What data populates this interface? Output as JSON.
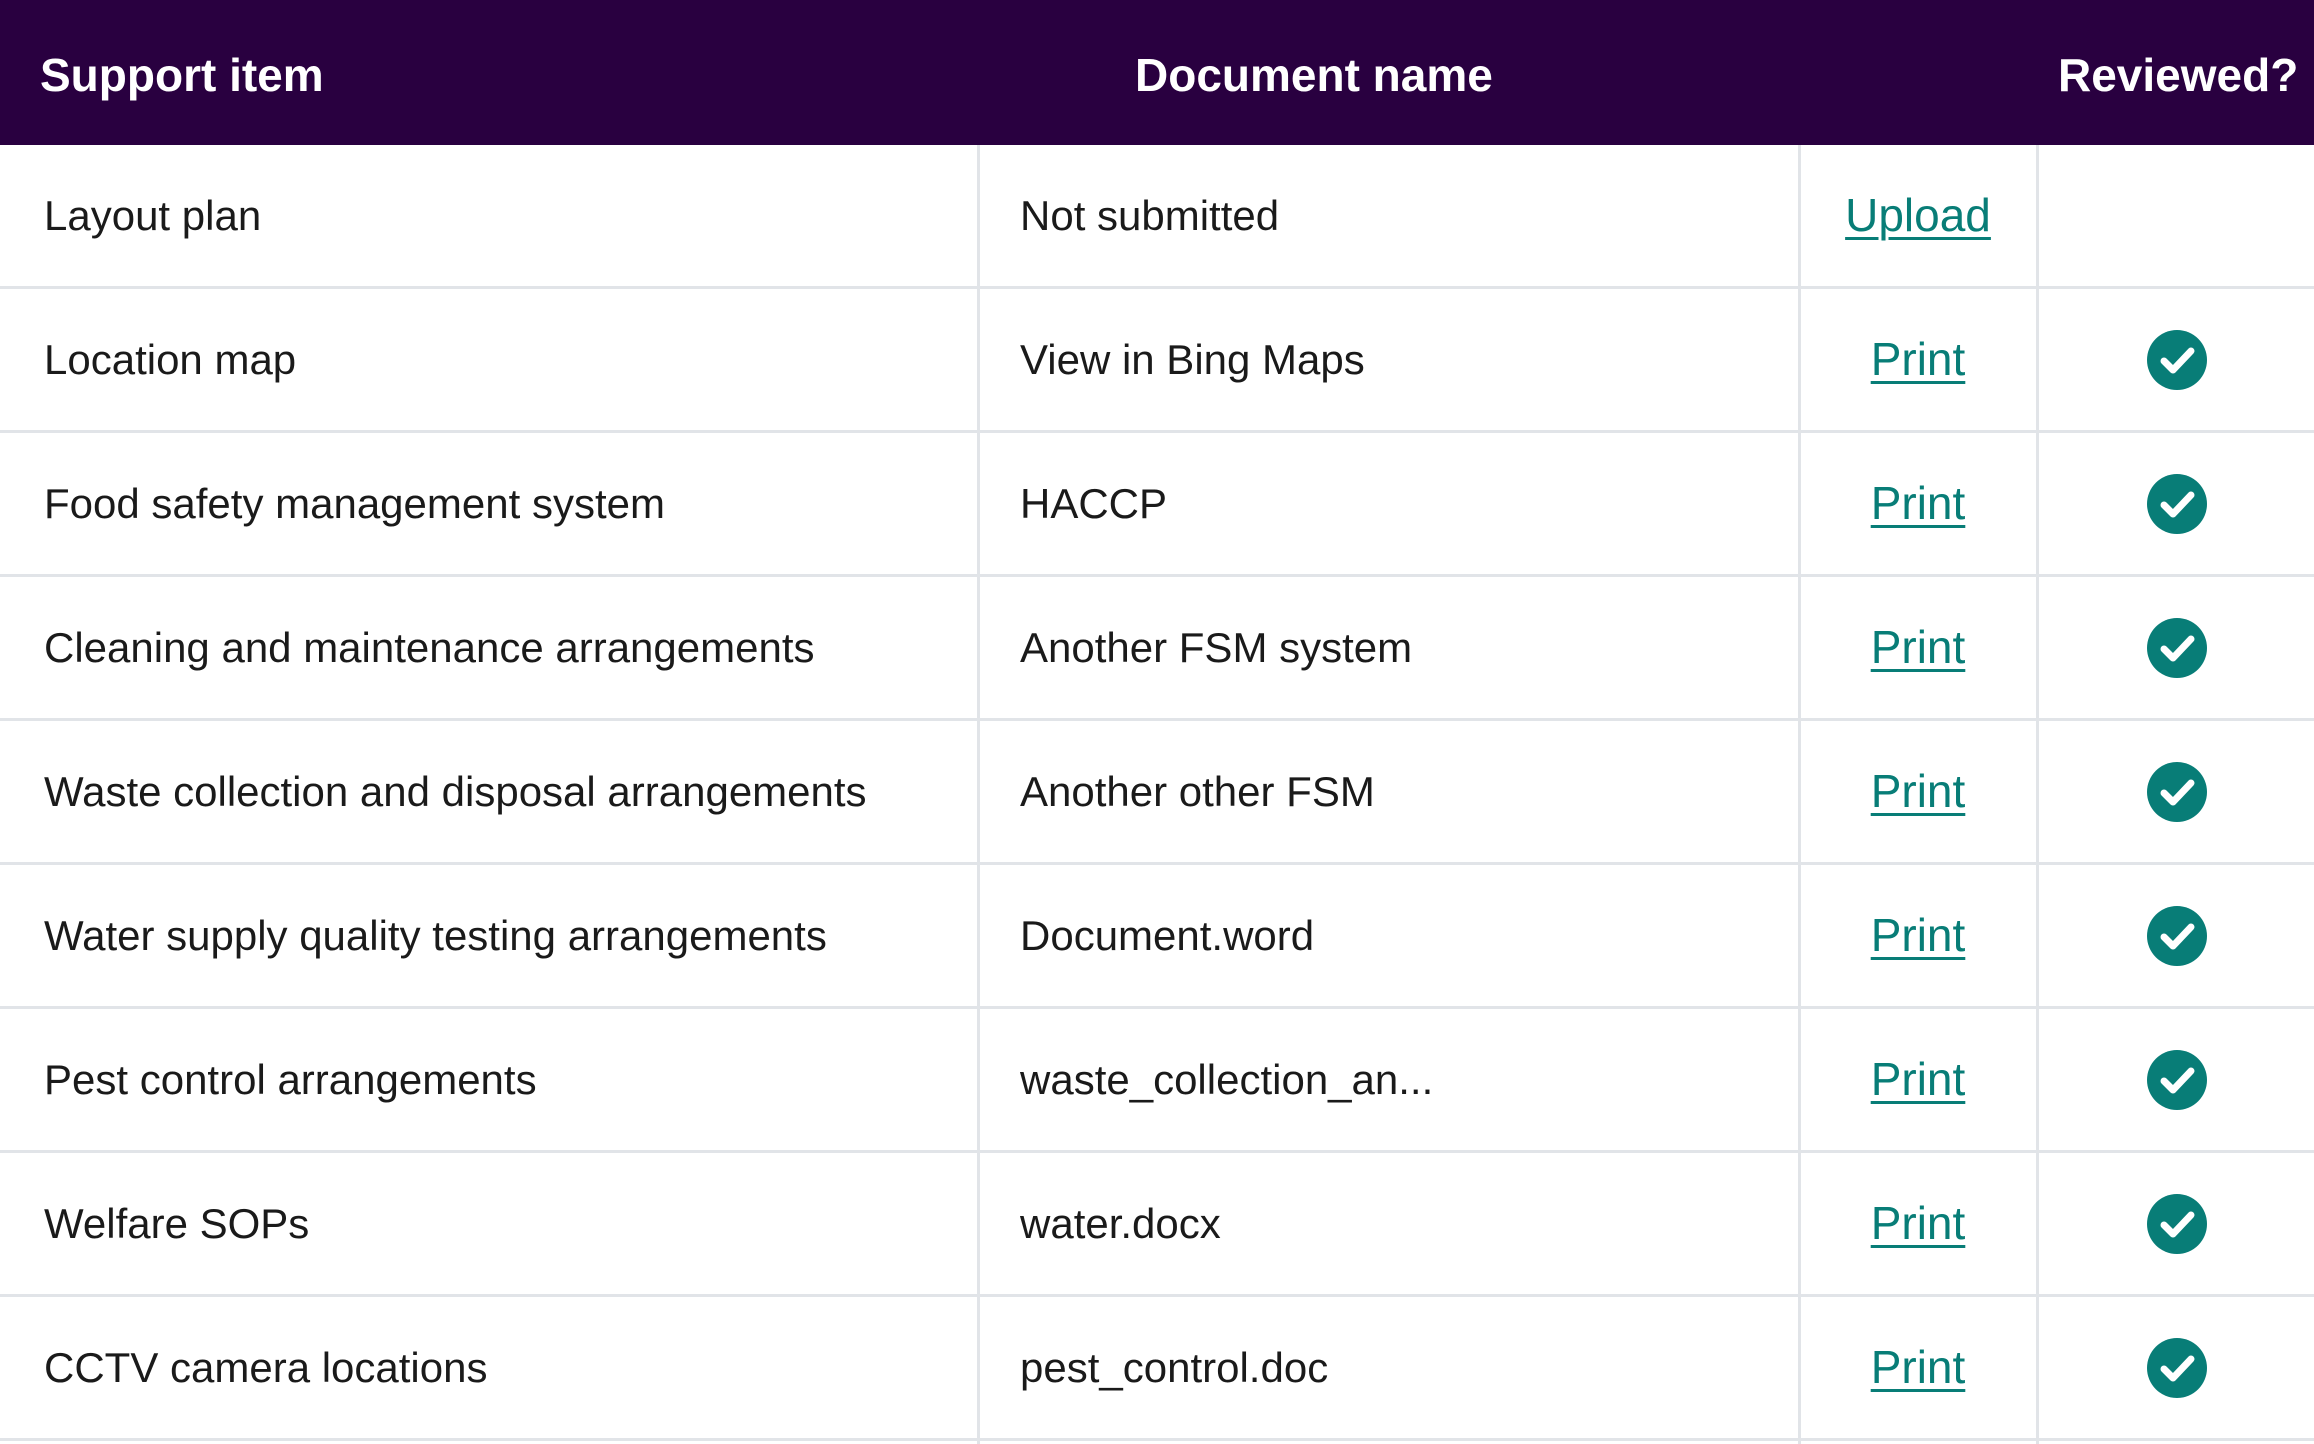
{
  "table": {
    "headers": {
      "support_item": "Support item",
      "document_name": "Document name",
      "reviewed": "Reviewed?"
    },
    "rows": [
      {
        "support_item": "Layout plan",
        "document_name": "Not submitted",
        "action": "Upload",
        "reviewed": false
      },
      {
        "support_item": "Location map",
        "document_name": "View in Bing Maps",
        "action": "Print",
        "reviewed": true
      },
      {
        "support_item": "Food safety management system",
        "document_name": "HACCP",
        "action": "Print",
        "reviewed": true
      },
      {
        "support_item": "Cleaning and maintenance arrangements",
        "document_name": "Another FSM system",
        "action": "Print",
        "reviewed": true
      },
      {
        "support_item": "Waste collection and disposal arrangements",
        "document_name": "Another other FSM",
        "action": "Print",
        "reviewed": true
      },
      {
        "support_item": "Water supply quality testing arrangements",
        "document_name": "Document.word",
        "action": "Print",
        "reviewed": true
      },
      {
        "support_item": "Pest control arrangements",
        "document_name": "waste_collection_an...",
        "action": "Print",
        "reviewed": true
      },
      {
        "support_item": "Welfare SOPs",
        "document_name": "water.docx",
        "action": "Print",
        "reviewed": true
      },
      {
        "support_item": "CCTV camera locations",
        "document_name": "pest_control.doc",
        "action": "Print",
        "reviewed": true
      }
    ]
  },
  "icons": {
    "reviewed": "check-circle-icon"
  },
  "colors": {
    "header_bg": "#290040",
    "header_text": "#ffffff",
    "link": "#087d77",
    "check": "#087d77",
    "border": "#e1e4e8"
  }
}
